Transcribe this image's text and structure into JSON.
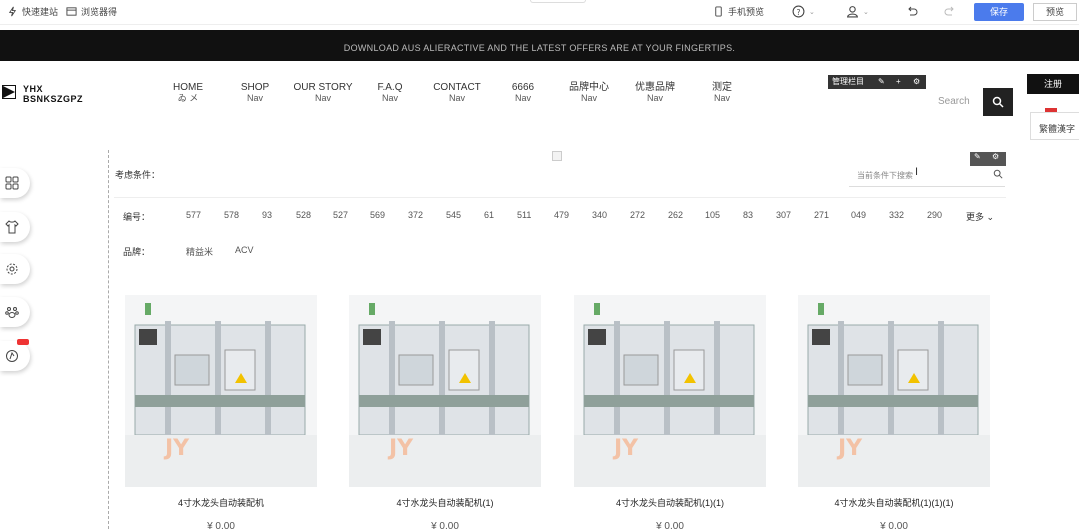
{
  "toolbar": {
    "items": [
      "快速建站",
      "浏览器得"
    ],
    "mobile_preview": "手机预览",
    "save": "保存",
    "preview": "预览"
  },
  "banner": {
    "text": "DOWNLOAD AUS ALIERACTIVE AND THE LATEST OFFERS ARE AT YOUR FINGERTIPS."
  },
  "header": {
    "logo_line1": "YHX",
    "logo_line2": "BSNKSZGPZ",
    "nav": [
      {
        "label": "HOME",
        "sub": "ゐ メ"
      },
      {
        "label": "SHOP",
        "sub": "Nav"
      },
      {
        "label": "OUR STORY",
        "sub": "Nav"
      },
      {
        "label": "F.A.Q",
        "sub": "Nav"
      },
      {
        "label": "CONTACT",
        "sub": "Nav"
      },
      {
        "label": "6666",
        "sub": "Nav"
      },
      {
        "label": "品牌中心",
        "sub": "Nav"
      },
      {
        "label": "优惠品牌",
        "sub": "Nav"
      },
      {
        "label": "测定",
        "sub": "Nav"
      }
    ],
    "manage_bar": "管理栏目",
    "search_label": "Search",
    "register": "注册",
    "lang": "繁體漢字"
  },
  "filters": {
    "title": "考虑条件：",
    "search_placeholder": "当前条件下搜索",
    "code_label": "编号：",
    "codes": [
      "577",
      "578",
      "93",
      "528",
      "527",
      "569",
      "372",
      "545",
      "61",
      "511",
      "479",
      "340",
      "272",
      "262",
      "105",
      "83",
      "307",
      "271",
      "049",
      "332",
      "290"
    ],
    "more": "更多",
    "brand_label": "品牌：",
    "brands": [
      "精益米",
      "ACV"
    ]
  },
  "products": [
    {
      "name": "4寸水龙头自动装配机",
      "price": "¥ 0.00"
    },
    {
      "name": "4寸水龙头自动装配机(1)",
      "price": "¥ 0.00"
    },
    {
      "name": "4寸水龙头自动装配机(1)(1)",
      "price": "¥ 0.00"
    },
    {
      "name": "4寸水龙头自动装配机(1)(1)(1)",
      "price": "¥ 0.00"
    }
  ],
  "colors": {
    "accent": "#4b7bec",
    "dark": "#111111",
    "badge": "#e33333"
  }
}
